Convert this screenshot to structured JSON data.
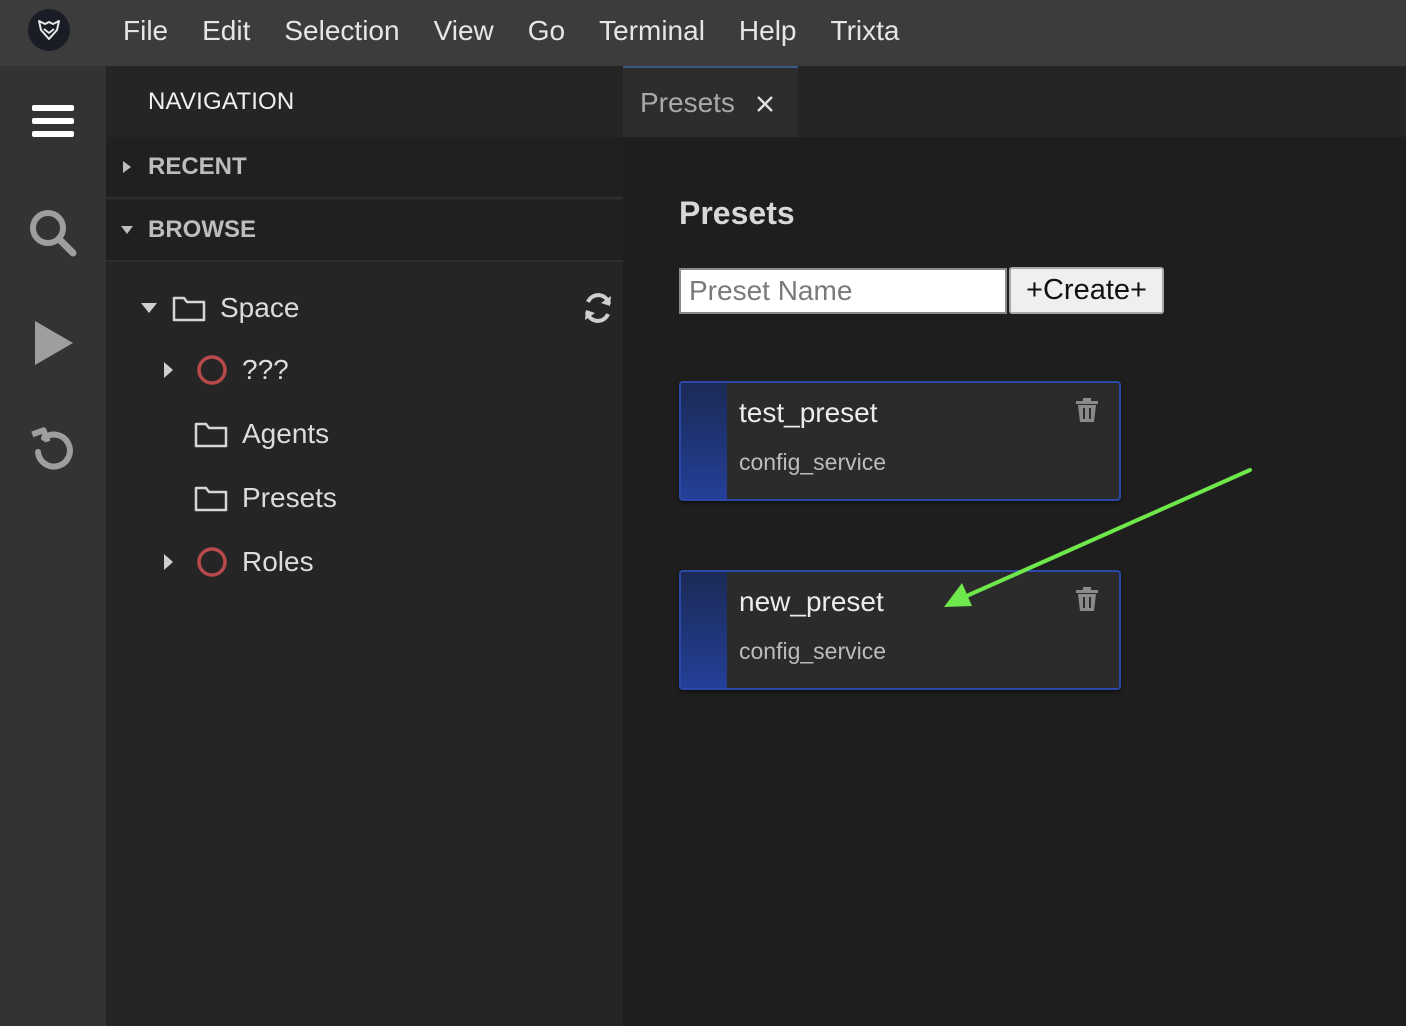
{
  "menubar": {
    "logo_icon": "fox-logo-icon",
    "items": [
      "File",
      "Edit",
      "Selection",
      "View",
      "Go",
      "Terminal",
      "Help",
      "Trixta"
    ]
  },
  "activity_bar": {
    "icons": [
      "hamburger-menu-icon",
      "search-icon",
      "play-icon",
      "undo-icon"
    ]
  },
  "sidebar": {
    "title": "NAVIGATION",
    "sections": [
      {
        "label": "RECENT",
        "expanded": false
      },
      {
        "label": "BROWSE",
        "expanded": true
      }
    ],
    "tree": {
      "root": {
        "label": "Space",
        "expanded": true
      },
      "children": [
        {
          "label": "???",
          "type": "circle",
          "expandable": true
        },
        {
          "label": "Agents",
          "type": "folder",
          "expandable": false
        },
        {
          "label": "Presets",
          "type": "folder",
          "expandable": false
        },
        {
          "label": "Roles",
          "type": "circle",
          "expandable": true
        }
      ]
    }
  },
  "tabs": [
    {
      "label": "Presets",
      "active": true
    }
  ],
  "presets_page": {
    "title": "Presets",
    "input_placeholder": "Preset Name",
    "input_value": "",
    "create_label": "+Create+",
    "cards": [
      {
        "name": "test_preset",
        "service": "config_service"
      },
      {
        "name": "new_preset",
        "service": "config_service"
      }
    ]
  },
  "colors": {
    "menubar_bg": "#3c3c3c",
    "sidebar_bg": "#252526",
    "editor_bg": "#1e1e1e",
    "card_border": "#2b47a8",
    "circle_red": "#b84a4a",
    "arrow_green": "#6ee84a"
  }
}
